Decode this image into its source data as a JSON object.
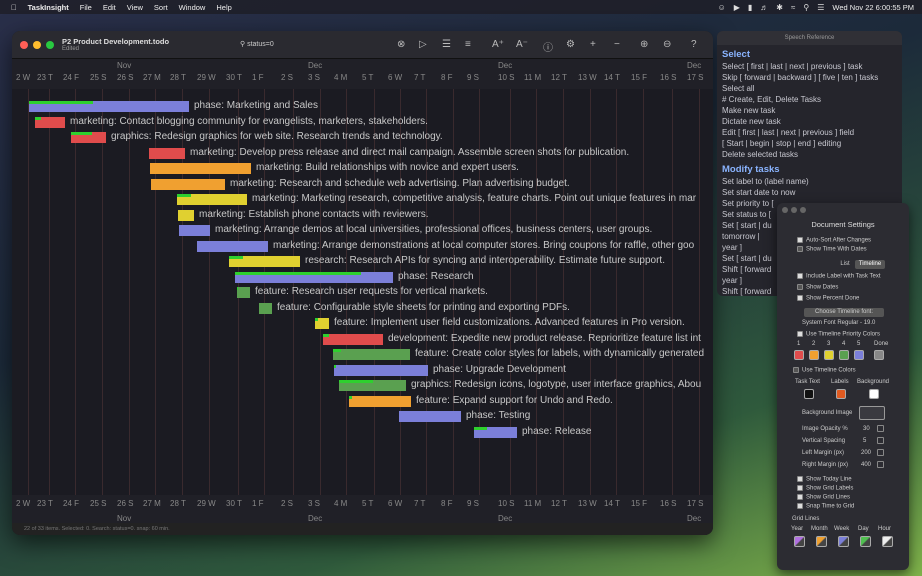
{
  "menubar": {
    "app": "TaskInsight",
    "items": [
      "File",
      "Edit",
      "View",
      "Sort",
      "Window",
      "Help"
    ],
    "clock": "Wed Nov 22  6:00:55 PM"
  },
  "window": {
    "title": "P2 Product Development.todo",
    "subtitle": "Edited",
    "search": "status=0",
    "status_bar": "22 of 33 items. Selected: 0. Search: status=0. snap: 60 min."
  },
  "ruler": {
    "days": [
      "2 W",
      "23 T",
      "24 F",
      "25 S",
      "26 S",
      "27 M",
      "28 T",
      "29 W",
      "30 T",
      "1 F",
      "2 S",
      "3 S",
      "4 M",
      "5 T",
      "6 W",
      "7 T",
      "8 F",
      "9 S",
      "10 S",
      "11 M",
      "12 T",
      "13 W",
      "14 T",
      "15 F",
      "16 S",
      "17 S"
    ],
    "months_top": [
      "Nov",
      "Dec",
      "Dec",
      "Dec"
    ],
    "months_bottom": [
      "Nov",
      "Dec",
      "Dec",
      "Dec"
    ]
  },
  "tasks": [
    {
      "label": "phase: Marketing and Sales",
      "color": "#7b7fd9",
      "pct": 0.4
    },
    {
      "label": "marketing: Contact blogging community for evangelists, marketers, stakeholders.",
      "color": "#e04c4c",
      "pct": 0.2
    },
    {
      "label": "graphics: Redesign graphics for web site. Research trends and technology.",
      "color": "#e04c4c",
      "pct": 0.6
    },
    {
      "label": "marketing: Develop press release and direct mail campaign. Assemble screen shots for publication.",
      "color": "#e04c4c",
      "pct": 0
    },
    {
      "label": "marketing: Build relationships with novice and expert users.",
      "color": "#f0a030",
      "pct": 0
    },
    {
      "label": "marketing: Research and schedule web advertising. Plan advertising budget.",
      "color": "#f0a030",
      "pct": 0
    },
    {
      "label": "marketing: Marketing research, competitive analysis, feature charts. Point out unique features in mar",
      "color": "#e0d030",
      "pct": 0.2
    },
    {
      "label": "marketing: Establish phone contacts with reviewers.",
      "color": "#e0d030",
      "pct": 0
    },
    {
      "label": "marketing: Arrange demos at local universities, professional offices, business centers, user groups.",
      "color": "#7b7fd9",
      "pct": 0
    },
    {
      "label": "marketing: Arrange demonstrations at local computer stores. Bring coupons for raffle, other goo",
      "color": "#7b7fd9",
      "pct": 0
    },
    {
      "label": "research: Research APIs for syncing and interoperability. Estimate future support.",
      "color": "#e0d030",
      "pct": 0.2
    },
    {
      "label": "phase: Research",
      "color": "#7b7fd9",
      "pct": 0.8
    },
    {
      "label": "feature: Research user requests for vertical markets.",
      "color": "#5aa050",
      "pct": 0.1
    },
    {
      "label": "feature: Configurable style sheets for printing and exporting PDFs.",
      "color": "#5aa050",
      "pct": 0
    },
    {
      "label": "feature: Implement user field customizations. Advanced features in Pro version.",
      "color": "#e0d030",
      "pct": 0.2
    },
    {
      "label": "development: Expedite new product release. Reprioritize feature list int",
      "color": "#e04c4c",
      "pct": 0.1
    },
    {
      "label": "feature: Create color styles for labels, with dynamically generated",
      "color": "#5aa050",
      "pct": 0.1
    },
    {
      "label": "phase: Upgrade Development",
      "color": "#7b7fd9",
      "pct": 0.02
    },
    {
      "label": "graphics: Redesign icons, logotype, user interface graphics, Abou",
      "color": "#5aa050",
      "pct": 0.5
    },
    {
      "label": "feature: Expand support for Undo and Redo.",
      "color": "#f0a030",
      "pct": 0.05
    },
    {
      "label": "phase: Testing",
      "color": "#7b7fd9",
      "pct": 0
    },
    {
      "label": "phase: Release",
      "color": "#7b7fd9",
      "pct": 0.3
    }
  ],
  "speech": {
    "title": "Speech Reference",
    "select_head": "Select",
    "select_lines": [
      "Select [ first | last | next | previous ] task",
      "Skip [ forward | backward ] [ five | ten ] tasks",
      "Select all",
      "# Create, Edit, Delete Tasks",
      "Make new task",
      "Dictate new task",
      "Edit [ first | last | next | previous ] field",
      "[ Start | begin | stop | end ] editing",
      "Delete selected tasks"
    ],
    "modify_head": "Modify tasks",
    "modify_lines": [
      "Set label to (label name)",
      "Set start date to now",
      "Set priority to [",
      "Set status to [",
      "Set [ start | du",
      "  tomorrow |",
      "  year ]",
      "Set [ start | du",
      "Shift [ forward",
      "  year ]",
      "Shift [ forward"
    ]
  },
  "doc_settings": {
    "title": "Document Settings",
    "auto_sort": "Auto-Sort After Changes",
    "show_time": "Show Time With Dates",
    "tab_list": "List",
    "tab_timeline": "Timeline",
    "include_label": "Include Label with Task Text",
    "show_dates": "Show Dates",
    "show_percent": "Show Percent Done",
    "choose_font": "Choose Timeline font:",
    "font_name": "System Font Regular - 19.0",
    "use_priority_colors": "Use Timeline Priority Colors",
    "priority_headers": [
      "1",
      "2",
      "3",
      "4",
      "5",
      "Done"
    ],
    "priority_colors": [
      "#e04c4c",
      "#f0a030",
      "#e0d030",
      "#5aa050",
      "#7b7fd9",
      "#888888"
    ],
    "use_timeline_colors": "Use Timeline Colors",
    "task_text": "Task Text",
    "labels": "Labels",
    "background": "Background",
    "task_text_color": "#111111",
    "labels_color": "#e05a20",
    "background_color": "#ffffff",
    "background_image": "Background Image",
    "image_opacity": "Image Opacity %",
    "image_opacity_val": "30",
    "vertical_spacing": "Vertical Spacing",
    "vertical_spacing_val": "5",
    "left_margin": "Left Margin (px)",
    "left_margin_val": "200",
    "right_margin": "Right Margin (px)",
    "right_margin_val": "400",
    "show_today": "Show Today Line",
    "show_grid_labels": "Show Grid Labels",
    "show_grid_lines": "Show Grid Lines",
    "snap_time": "Snap Time to Grid",
    "grid_lines": "Grid Lines",
    "grid_units": [
      "Year",
      "Month",
      "Week",
      "Day",
      "Hour"
    ]
  }
}
